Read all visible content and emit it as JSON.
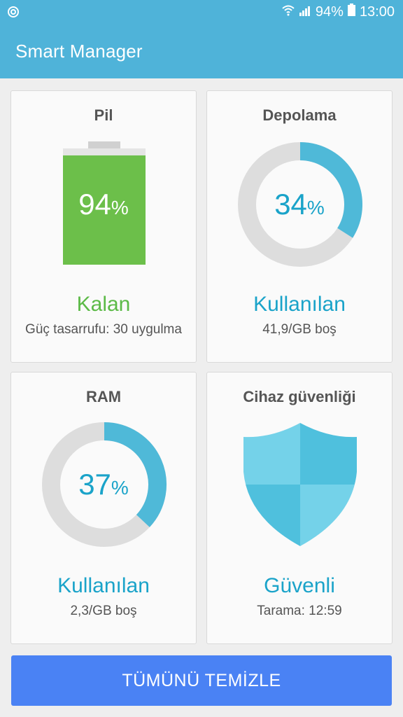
{
  "status_bar": {
    "battery_text": "94%",
    "time": "13:00",
    "left_icon": "smart-manager-status-icon",
    "wifi_icon": "wifi-icon",
    "signal_icon": "signal-icon",
    "battery_icon": "battery-icon"
  },
  "app_bar": {
    "title": "Smart Manager"
  },
  "cards": {
    "battery": {
      "title": "Pil",
      "value": "94",
      "unit": "%",
      "level": 0.94,
      "status": "Kalan",
      "subtitle": "Güç tasarrufu: 30 uygulma",
      "color": "#5cba47"
    },
    "storage": {
      "title": "Depolama",
      "value": "34",
      "unit": "%",
      "fraction": 0.34,
      "status": "Kullanılan",
      "subtitle": "41,9/GB boş",
      "color": "#4fb3d9"
    },
    "ram": {
      "title": "RAM",
      "value": "37",
      "unit": "%",
      "fraction": 0.37,
      "status": "Kullanılan",
      "subtitle": "2,3/GB boş",
      "color": "#4fb3d9"
    },
    "security": {
      "title": "Cihaz güvenliği",
      "status": "Güvenli",
      "subtitle": "Tarama: 12:59",
      "icon": "shield-icon"
    }
  },
  "action_button": {
    "label": "TÜMÜNÜ TEMİZLE"
  }
}
